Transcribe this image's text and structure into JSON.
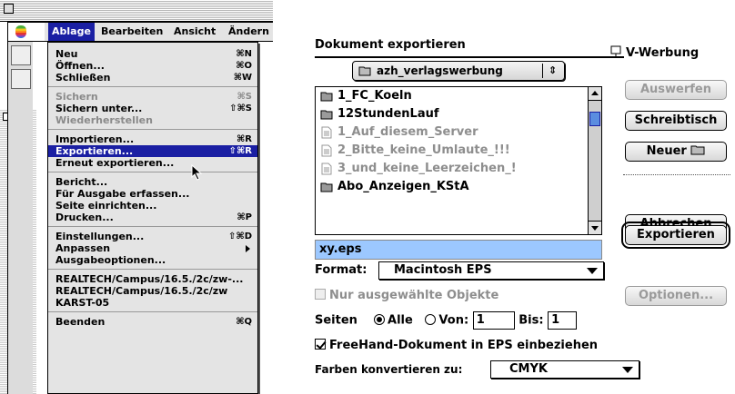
{
  "menubar": {
    "items": [
      "Ablage",
      "Bearbeiten",
      "Ansicht",
      "Ändern"
    ],
    "active": "Ablage"
  },
  "menu": {
    "groups": [
      [
        {
          "label": "Neu",
          "shortcut": "⌘N",
          "enabled": true
        },
        {
          "label": "Öffnen...",
          "shortcut": "⌘O",
          "enabled": true
        },
        {
          "label": "Schließen",
          "shortcut": "⌘W",
          "enabled": true
        }
      ],
      [
        {
          "label": "Sichern",
          "shortcut": "⌘S",
          "enabled": false
        },
        {
          "label": "Sichern unter...",
          "shortcut": "⇧⌘S",
          "enabled": true
        },
        {
          "label": "Wiederherstellen",
          "shortcut": "",
          "enabled": false
        }
      ],
      [
        {
          "label": "Importieren...",
          "shortcut": "⌘R",
          "enabled": true
        },
        {
          "label": "Exportieren...",
          "shortcut": "⇧⌘R",
          "enabled": true,
          "highlighted": true
        },
        {
          "label": "Erneut exportieren...",
          "shortcut": "",
          "enabled": true
        }
      ],
      [
        {
          "label": "Bericht...",
          "shortcut": "",
          "enabled": true
        },
        {
          "label": "Für Ausgabe erfassen...",
          "shortcut": "",
          "enabled": true
        },
        {
          "label": "Seite einrichten...",
          "shortcut": "",
          "enabled": true
        },
        {
          "label": "Drucken...",
          "shortcut": "⌘P",
          "enabled": true
        }
      ],
      [
        {
          "label": "Einstellungen...",
          "shortcut": "⇧⌘D",
          "enabled": true
        },
        {
          "label": "Anpassen",
          "shortcut": "",
          "enabled": true,
          "submenu": true
        },
        {
          "label": "Ausgabeoptionen...",
          "shortcut": "",
          "enabled": true
        }
      ],
      [
        {
          "label": "REALTECH/Campus/16.5./2c/zw-...",
          "shortcut": "",
          "enabled": true
        },
        {
          "label": "REALTECH/Campus/16.5./2c/zw",
          "shortcut": "",
          "enabled": true
        },
        {
          "label": "KARST-05",
          "shortcut": "",
          "enabled": true
        }
      ],
      [
        {
          "label": "Beenden",
          "shortcut": "⌘Q",
          "enabled": true
        }
      ]
    ]
  },
  "dialog": {
    "title": "Dokument exportieren",
    "folder_popup": "azh_verlagswerbung",
    "volume": "V-Werbung",
    "files": [
      {
        "name": "1_FC_Koeln",
        "type": "folder",
        "enabled": true
      },
      {
        "name": "12StundenLauf",
        "type": "folder",
        "enabled": true
      },
      {
        "name": "1_Auf_diesem_Server",
        "type": "document",
        "enabled": false
      },
      {
        "name": "2_Bitte_keine_Umlaute_!!!",
        "type": "document",
        "enabled": false
      },
      {
        "name": "3_und_keine_Leerzeichen_!",
        "type": "document",
        "enabled": false
      },
      {
        "name": "Abo_Anzeigen_KStA",
        "type": "folder",
        "enabled": true
      }
    ],
    "buttons": {
      "eject": "Auswerfen",
      "desktop": "Schreibtisch",
      "new_folder": "Neuer",
      "cancel": "Abbrechen",
      "export": "Exportieren",
      "options": "Optionen..."
    },
    "filename": "xy.eps",
    "format_label": "Format:",
    "format_value": "Macintosh EPS",
    "selected_only_label": "Nur ausgewählte Objekte",
    "pages_label": "Seiten",
    "pages_all": "Alle",
    "pages_from": "Von:",
    "pages_from_value": "1",
    "pages_to": "Bis:",
    "pages_to_value": "1",
    "include_doc_label": "FreeHand-Dokument in EPS einbeziehen",
    "convert_label": "Farben konvertieren zu:",
    "convert_value": "CMYK"
  }
}
